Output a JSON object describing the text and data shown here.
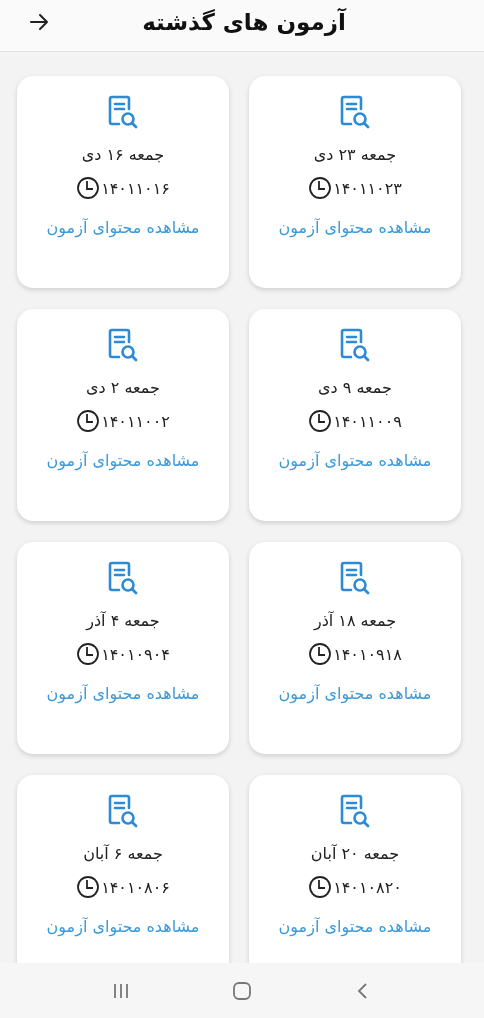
{
  "header": {
    "title": "آزمون های گذشته"
  },
  "exams": [
    {
      "title": "جمعه ۲۳ دی",
      "date": "۱۴۰۱۱۰۲۳",
      "link": "مشاهده محتوای آزمون"
    },
    {
      "title": "جمعه ۱۶ دی",
      "date": "۱۴۰۱۱۰۱۶",
      "link": "مشاهده محتوای آزمون"
    },
    {
      "title": "جمعه ۹ دی",
      "date": "۱۴۰۱۱۰۰۹",
      "link": "مشاهده محتوای آزمون"
    },
    {
      "title": "جمعه ۲ دی",
      "date": "۱۴۰۱۱۰۰۲",
      "link": "مشاهده محتوای آزمون"
    },
    {
      "title": "جمعه ۱۸ آذر",
      "date": "۱۴۰۱۰۹۱۸",
      "link": "مشاهده محتوای آزمون"
    },
    {
      "title": "جمعه ۴ آذر",
      "date": "۱۴۰۱۰۹۰۴",
      "link": "مشاهده محتوای آزمون"
    },
    {
      "title": "جمعه ۲۰ آبان",
      "date": "۱۴۰۱۰۸۲۰",
      "link": "مشاهده محتوای آزمون"
    },
    {
      "title": "جمعه ۶ آبان",
      "date": "۱۴۰۱۰۸۰۶",
      "link": "مشاهده محتوای آزمون"
    }
  ]
}
